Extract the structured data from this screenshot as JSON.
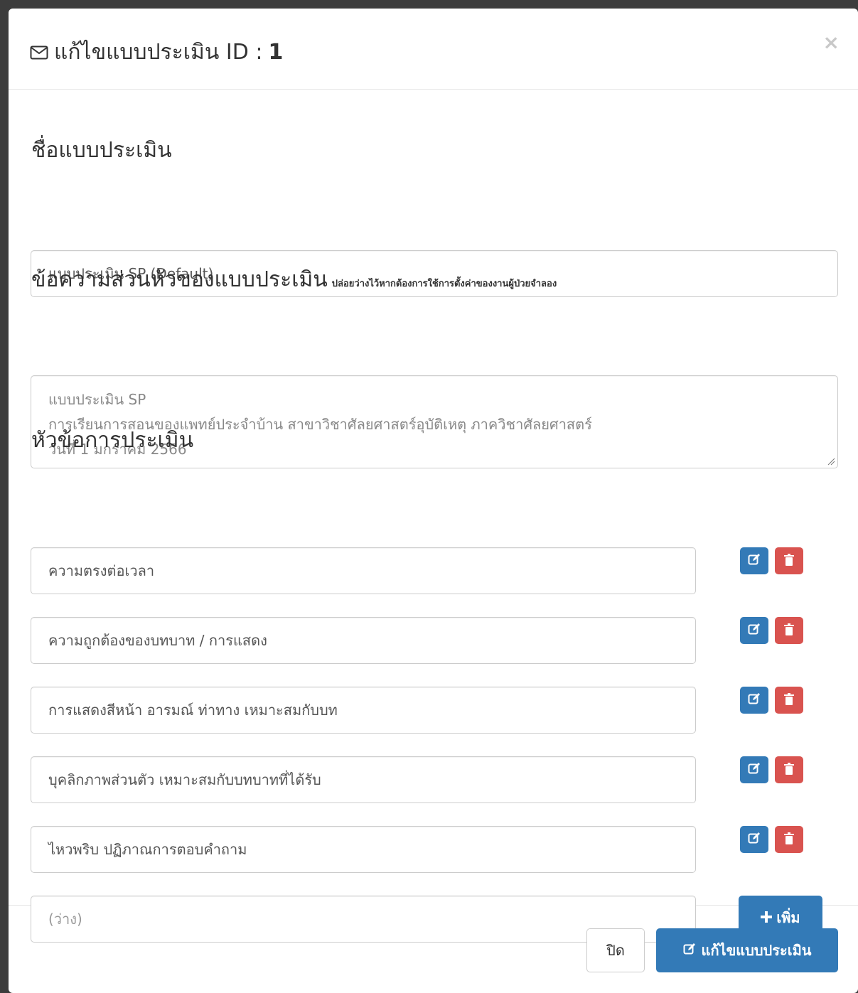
{
  "modal": {
    "title_prefix": "แก้ไขแบบประเมิน ID :",
    "title_id": "1",
    "close_symbol": "×"
  },
  "form": {
    "name_label": "ชื่อแบบประเมิน",
    "name_value": "แบบประเมิน SP (Default)",
    "header_label": "ข้อความส่วนหัวของแบบประเมิน",
    "header_hint": "ปล่อยว่างไว้หากต้องการใช้การตั้งค่าของงานผู้ป่วยจำลอง",
    "header_lines": [
      "แบบประเมิน SP",
      "การเรียนการสอนของแพทย์ประจำบ้าน สาขาวิชาศัลยศาสตร์อุบัติเหตุ ภาควิชาศัลยศาสตร์",
      "วันที่ 1 มกราคม 2566"
    ],
    "topics_label": "หัวข้อการประเมิน",
    "topics": [
      "ความตรงต่อเวลา",
      "ความถูกต้องของบทบาท / การแสดง",
      "การแสดงสีหน้า อารมณ์ ท่าทาง เหมาะสมกับบท",
      "บุคลิกภาพส่วนตัว เหมาะสมกับบทบาทที่ได้รับ",
      "ไหวพริบ ปฏิภาณการตอบคำถาม"
    ],
    "new_topic_placeholder": "(ว่าง)",
    "add_label": "เพิ่ม"
  },
  "footer": {
    "close_label": "ปิด",
    "submit_label": "แก้ไขแบบประเมิน"
  },
  "colors": {
    "primary": "#337ab7",
    "danger": "#d9534f"
  },
  "icons": {
    "title": "envelope-icon",
    "edit": "edit-icon",
    "delete": "trash-icon",
    "add": "plus-icon"
  }
}
